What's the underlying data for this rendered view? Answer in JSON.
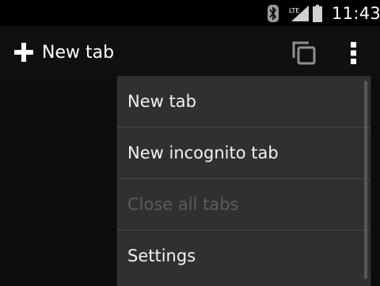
{
  "status_bar": {
    "time": "11:43",
    "icons": [
      "bluetooth-icon",
      "lte-signal-icon",
      "battery-icon"
    ],
    "network_label": "LTE"
  },
  "action_bar": {
    "new_tab_label": "New tab",
    "new_tab_icon": "plus-icon",
    "tab_switcher_icon": "tab-switcher-icon",
    "overflow_icon": "overflow-menu-icon"
  },
  "menu": {
    "items": [
      {
        "label": "New tab",
        "enabled": true
      },
      {
        "label": "New incognito tab",
        "enabled": true
      },
      {
        "label": "Close all tabs",
        "enabled": false
      },
      {
        "label": "Settings",
        "enabled": true
      }
    ]
  },
  "colors": {
    "background": "#0b0b0b",
    "menu_background": "#303030",
    "disabled_text": "#5c5c5c",
    "text": "#f2f2f2"
  }
}
